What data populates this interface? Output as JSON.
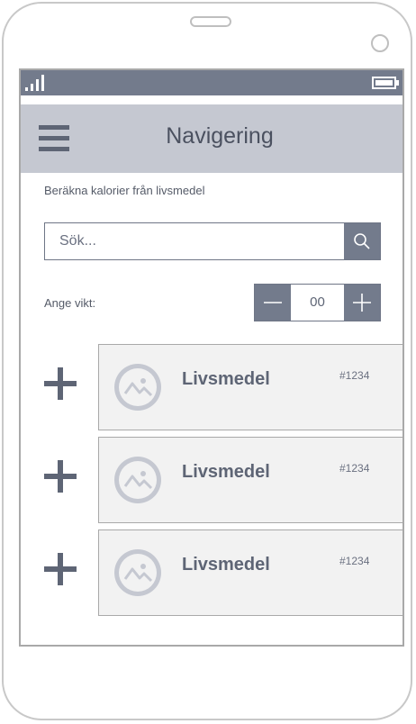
{
  "nav": {
    "title": "Navigering",
    "menu_icon": "hamburger-menu-icon"
  },
  "status_bar": {
    "signal_icon": "signal-icon",
    "battery_icon": "battery-icon"
  },
  "subtitle": "Beräkna kalorier från livsmedel",
  "search": {
    "placeholder": "Sök...",
    "value": "",
    "icon": "search-icon"
  },
  "weight": {
    "label": "Ange vikt:",
    "value": "00"
  },
  "items": [
    {
      "title": "Livsmedel",
      "id": "#1234"
    },
    {
      "title": "Livsmedel",
      "id": "#1234"
    },
    {
      "title": "Livsmedel",
      "id": "#1234"
    }
  ],
  "colors": {
    "primary": "#737b8c",
    "nav_bg": "#c5c8d1",
    "card_bg": "#f2f2f2",
    "text": "#5e6575"
  }
}
